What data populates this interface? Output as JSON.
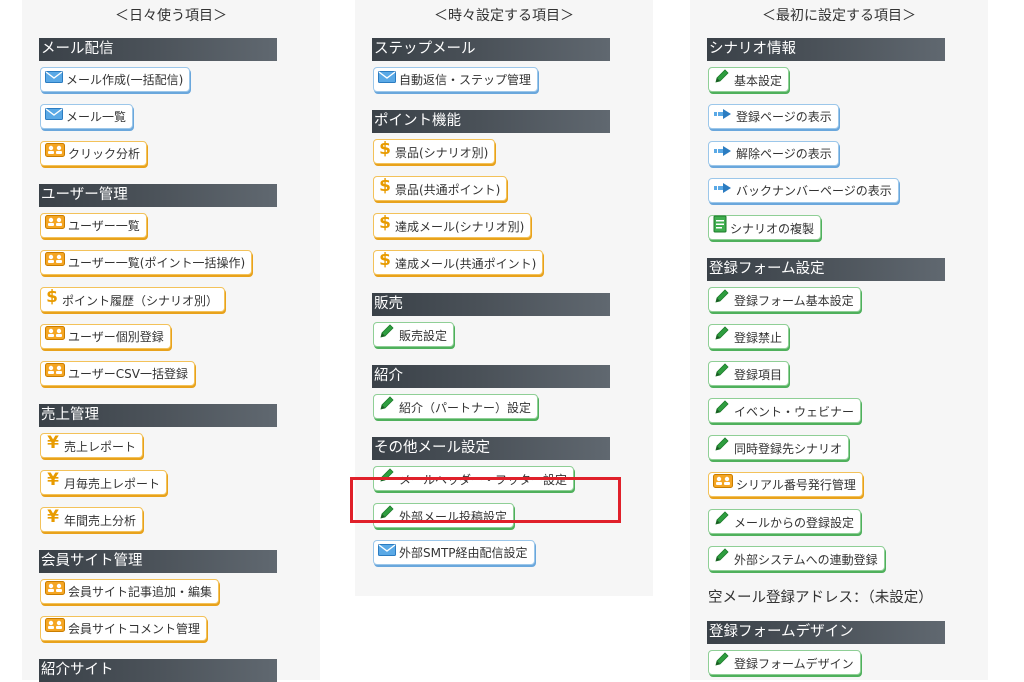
{
  "col1": {
    "title": "＜日々使う項目＞",
    "sections": [
      {
        "header": "メール配信",
        "buttons": [
          {
            "label": "メール作成(一括配信)",
            "icon": "mail-icon"
          },
          {
            "label": "メール一覧",
            "icon": "mail-icon"
          },
          {
            "label": "クリック分析",
            "icon": "users-icon"
          }
        ]
      },
      {
        "header": "ユーザー管理",
        "buttons": [
          {
            "label": "ユーザー一覧",
            "icon": "users-icon"
          },
          {
            "label": "ユーザー一覧(ポイント一括操作)",
            "icon": "users-icon"
          },
          {
            "label": "ポイント履歴（シナリオ別）",
            "icon": "dollar-icon"
          },
          {
            "label": "ユーザー個別登録",
            "icon": "users-icon"
          },
          {
            "label": "ユーザーCSV一括登録",
            "icon": "users-icon"
          }
        ]
      },
      {
        "header": "売上管理",
        "buttons": [
          {
            "label": "売上レポート",
            "icon": "yen-icon"
          },
          {
            "label": "月毎売上レポート",
            "icon": "yen-icon"
          },
          {
            "label": "年間売上分析",
            "icon": "yen-icon"
          }
        ]
      },
      {
        "header": "会員サイト管理",
        "buttons": [
          {
            "label": "会員サイト記事追加・編集",
            "icon": "users-icon"
          },
          {
            "label": "会員サイトコメント管理",
            "icon": "users-icon"
          }
        ]
      },
      {
        "header": "紹介サイト",
        "buttons": []
      }
    ]
  },
  "col2": {
    "title": "＜時々設定する項目＞",
    "sections": [
      {
        "header": "ステップメール",
        "buttons": [
          {
            "label": "自動返信・ステップ管理",
            "icon": "mail-icon"
          }
        ]
      },
      {
        "header": "ポイント機能",
        "buttons": [
          {
            "label": "景品(シナリオ別)",
            "icon": "dollar-icon"
          },
          {
            "label": "景品(共通ポイント)",
            "icon": "dollar-icon"
          },
          {
            "label": "達成メール(シナリオ別)",
            "icon": "dollar-icon"
          },
          {
            "label": "達成メール(共通ポイント)",
            "icon": "dollar-icon"
          }
        ]
      },
      {
        "header": "販売",
        "buttons": [
          {
            "label": "販売設定",
            "icon": "pencil-icon"
          }
        ]
      },
      {
        "header": "紹介",
        "buttons": [
          {
            "label": "紹介（パートナー）設定",
            "icon": "pencil-icon"
          }
        ]
      },
      {
        "header": "その他メール設定",
        "buttons": [
          {
            "label": "メールヘッダー・フッター設定",
            "icon": "pencil-icon"
          },
          {
            "label": "外部メール投稿設定",
            "icon": "pencil-icon"
          },
          {
            "label": "外部SMTP経由配信設定",
            "icon": "mail-icon"
          }
        ]
      }
    ]
  },
  "col3": {
    "title": "＜最初に設定する項目＞",
    "sections": [
      {
        "header": "シナリオ情報",
        "buttons": [
          {
            "label": "基本設定",
            "icon": "pencil-icon"
          },
          {
            "label": "登録ページの表示",
            "icon": "arrow-icon"
          },
          {
            "label": "解除ページの表示",
            "icon": "arrow-icon"
          },
          {
            "label": "バックナンバーページの表示",
            "icon": "arrow-icon"
          },
          {
            "label": "シナリオの複製",
            "icon": "document-icon"
          }
        ]
      },
      {
        "header": "登録フォーム設定",
        "buttons": [
          {
            "label": "登録フォーム基本設定",
            "icon": "pencil-icon"
          },
          {
            "label": "登録禁止",
            "icon": "pencil-icon"
          },
          {
            "label": "登録項目",
            "icon": "pencil-icon"
          },
          {
            "label": "イベント・ウェビナー",
            "icon": "pencil-icon"
          },
          {
            "label": "同時登録先シナリオ",
            "icon": "pencil-icon"
          },
          {
            "label": "シリアル番号発行管理",
            "icon": "users-icon"
          },
          {
            "label": "メールからの登録設定",
            "icon": "pencil-icon"
          },
          {
            "label": "外部システムへの連動登録",
            "icon": "pencil-icon"
          }
        ],
        "note": "空メール登録アドレス：（未設定）"
      },
      {
        "header": "登録フォームデザイン",
        "buttons": [
          {
            "label": "登録フォームデザイン",
            "icon": "pencil-icon"
          }
        ]
      }
    ]
  },
  "colors": {
    "highlight": "#e0202a",
    "header_bg": "#3a4148"
  }
}
